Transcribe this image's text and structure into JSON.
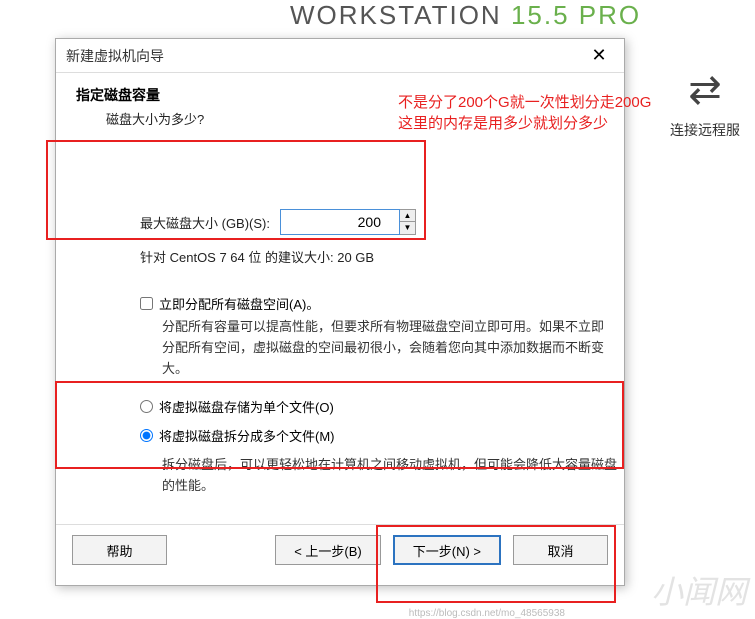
{
  "bg": {
    "title_a": "WORKSTATION",
    "title_b": "15.5",
    "title_c": "PRO",
    "side_label": "连接远程服"
  },
  "dialog": {
    "title": "新建虚拟机向导",
    "header": {
      "h1": "指定磁盘容量",
      "h2": "磁盘大小为多少?"
    },
    "disk": {
      "max_label": "最大磁盘大小 (GB)(S):",
      "value": "200",
      "suggest": "针对 CentOS 7 64 位 的建议大小: 20 GB"
    },
    "allocate": {
      "label": "立即分配所有磁盘空间(A)。",
      "desc": "分配所有容量可以提高性能，但要求所有物理磁盘空间立即可用。如果不立即分配所有空间，虚拟磁盘的空间最初很小，会随着您向其中添加数据而不断变大。"
    },
    "radios": {
      "single": "将虚拟磁盘存储为单个文件(O)",
      "multi": "将虚拟磁盘拆分成多个文件(M)",
      "multi_desc": "拆分磁盘后，可以更轻松地在计算机之间移动虚拟机，但可能会降低大容量磁盘的性能。"
    },
    "buttons": {
      "help": "帮助",
      "back": "< 上一步(B)",
      "next": "下一步(N) >",
      "cancel": "取消"
    }
  },
  "annotation": {
    "line1": "不是分了200个G就一次性划分走200G",
    "line2": "这里的内存是用多少就划分多少"
  },
  "watermark": "小闻网",
  "wm2": "https://blog.csdn.net/mo_48565938"
}
